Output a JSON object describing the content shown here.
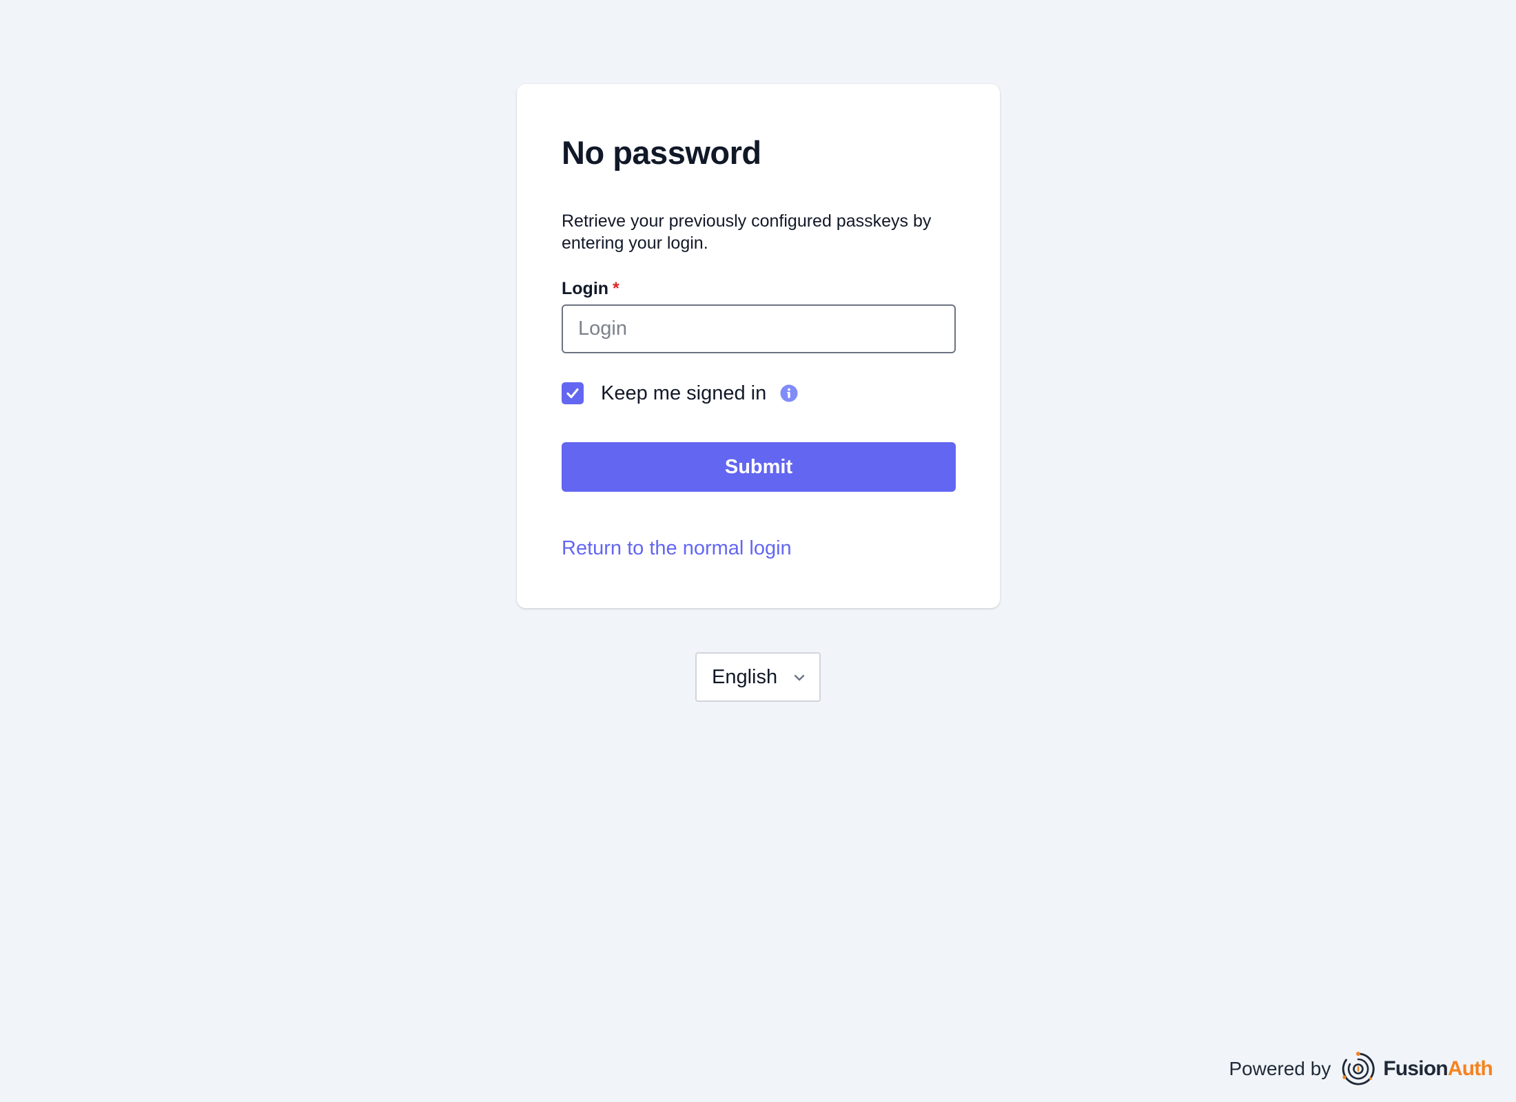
{
  "card": {
    "title": "No password",
    "description": "Retrieve your previously configured passkeys by entering your login.",
    "login_label": "Login",
    "required_marker": "*",
    "login_placeholder": "Login",
    "login_value": "",
    "keep_signed_in_label": "Keep me signed in",
    "keep_signed_in_checked": true,
    "submit_label": "Submit",
    "return_link": "Return to the normal login"
  },
  "language": {
    "selected": "English"
  },
  "footer": {
    "powered_by": "Powered by",
    "brand_part1": "Fusion",
    "brand_part2": "Auth"
  },
  "colors": {
    "background": "#f1f4f8",
    "accent": "#6366f1",
    "required": "#dc2626",
    "brand_orange": "#f58320"
  },
  "icons": {
    "checkbox": "check-icon",
    "info": "info-icon",
    "language": "chevron-down-icon",
    "logo": "fusionauth-logo-icon"
  }
}
